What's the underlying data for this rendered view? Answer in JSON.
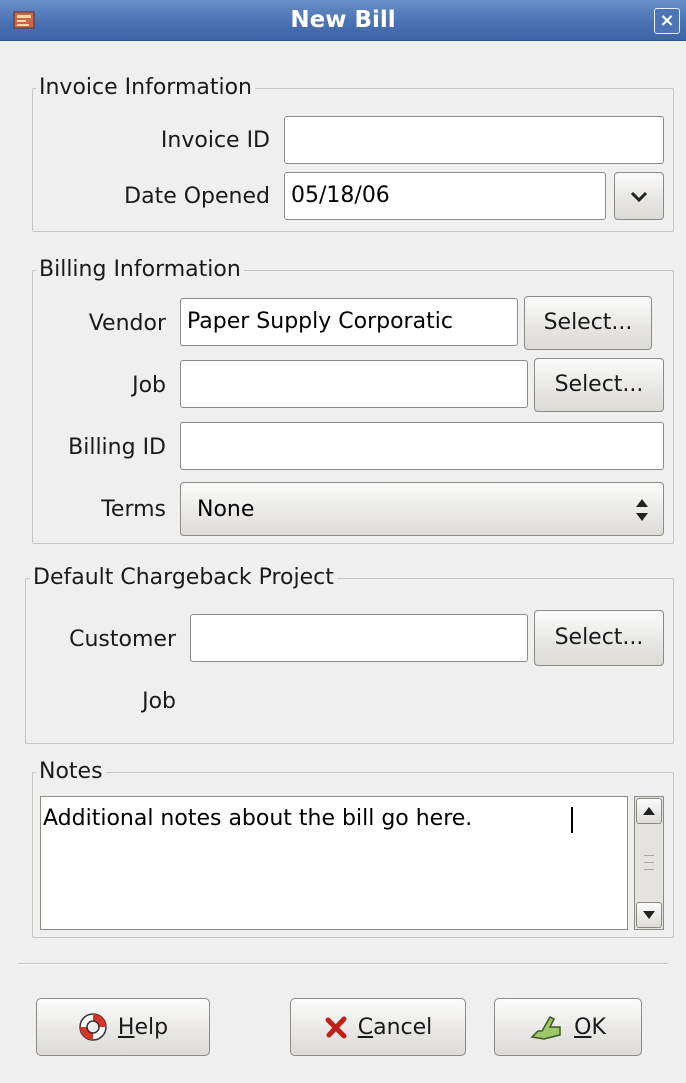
{
  "window": {
    "title": "New Bill",
    "close_label": "×"
  },
  "invoice": {
    "legend": "Invoice Information",
    "id_label": "Invoice ID",
    "id_value": "",
    "date_label": "Date Opened",
    "date_value": "05/18/06"
  },
  "billing": {
    "legend": "Billing Information",
    "vendor_label": "Vendor",
    "vendor_value": "Paper Supply Corporatic",
    "vendor_select": "Select...",
    "job_label": "Job",
    "job_value": "",
    "job_select": "Select...",
    "billing_id_label": "Billing ID",
    "billing_id_value": "",
    "terms_label": "Terms",
    "terms_value": "None"
  },
  "chargeback": {
    "legend": "Default Chargeback Project",
    "customer_label": "Customer",
    "customer_value": "",
    "customer_select": "Select...",
    "job_label": "Job"
  },
  "notes": {
    "legend": "Notes",
    "text": "Additional notes about the bill go here."
  },
  "buttons": {
    "help_mnemonic": "H",
    "help_rest": "elp",
    "cancel_mnemonic": "C",
    "cancel_rest": "ancel",
    "ok_mnemonic": "O",
    "ok_rest": "K"
  },
  "colors": {
    "titlebar": "#4a72b3",
    "background": "#efefef"
  }
}
